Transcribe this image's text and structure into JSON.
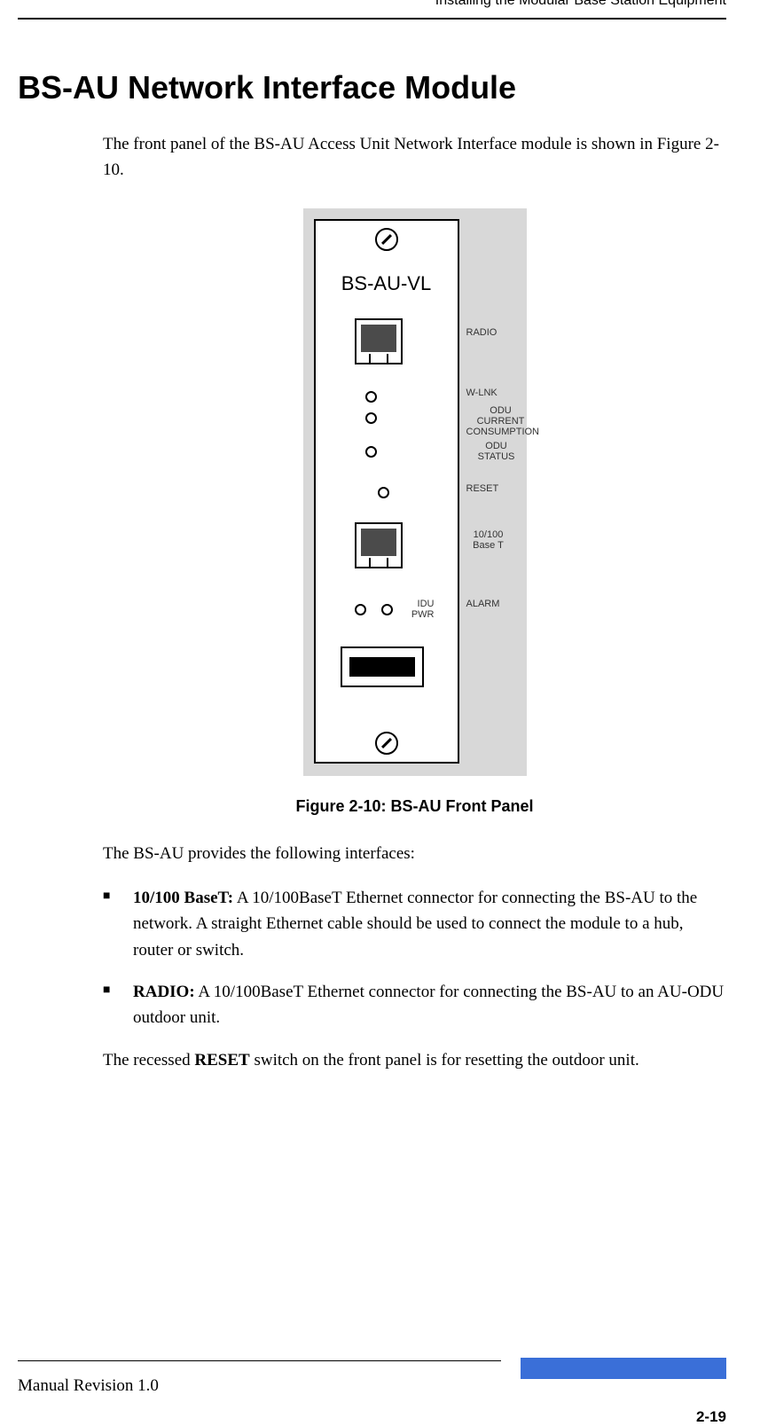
{
  "header": {
    "running": "Installing the Modular Base Station Equipment"
  },
  "title": "BS-AU Network Interface Module",
  "intro": "The front panel of the BS-AU Access Unit Network Interface module is shown in Figure 2-10.",
  "figure": {
    "panel_label": "BS-AU-VL",
    "labels": {
      "radio": "RADIO",
      "wlnk": "W-LNK",
      "odu_curr": "ODU CURRENT CONSUMPTION",
      "odu_status": "ODU STATUS",
      "reset": "RESET",
      "tenhun": "10/100 Base T",
      "idu_pwr": "IDU PWR",
      "alarm": "ALARM"
    },
    "caption": "Figure 2-10: BS-AU Front Panel"
  },
  "interfaces_lead": "The BS-AU provides the following interfaces:",
  "bullets": [
    {
      "label": "10/100 BaseT:",
      "text": " A 10/100BaseT Ethernet connector for connecting the BS-AU to the network. A straight Ethernet cable should be used to connect the module to a hub, router or switch."
    },
    {
      "label": "RADIO:",
      "text": " A 10/100BaseT Ethernet connector for connecting the BS-AU to an AU-ODU outdoor unit."
    }
  ],
  "reset_para_pre": "The recessed ",
  "reset_bold": "RESET",
  "reset_para_post": " switch on the front panel is for resetting the outdoor unit.",
  "footer": {
    "rev": "Manual Revision 1.0",
    "page": "2-19"
  }
}
